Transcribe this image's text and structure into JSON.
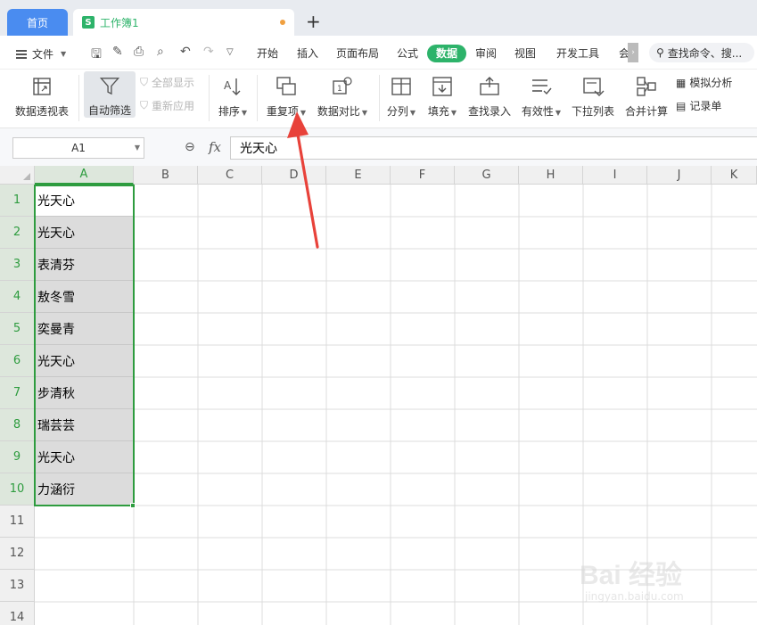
{
  "tabs": {
    "home": "首页",
    "doc_icon": "S",
    "doc_name": "工作簿1",
    "add": "+"
  },
  "menu": {
    "file": "文件",
    "tabs": [
      "开始",
      "插入",
      "页面布局",
      "公式",
      "数据",
      "审阅",
      "视图",
      "开发工具",
      "会"
    ],
    "active_tab": "数据",
    "search": "查找命令、搜...",
    "accent_color": "#2db36a"
  },
  "ribbon": {
    "pivot": "数据透视表",
    "autofilter": "自动筛选",
    "show_all": "全部显示",
    "reapply": "重新应用",
    "sort": "排序",
    "duplicates": "重复项",
    "compare": "数据对比",
    "split": "分列",
    "fill": "填充",
    "lookup_entry": "查找录入",
    "validity": "有效性",
    "dropdown_list": "下拉列表",
    "consolidate": "合并计算",
    "whatif": "模拟分析",
    "record": "记录单"
  },
  "formula_bar": {
    "name_box": "A1",
    "fx": "fx",
    "value": "光天心"
  },
  "sheet": {
    "columns": [
      "A",
      "B",
      "C",
      "D",
      "E",
      "F",
      "G",
      "H",
      "I",
      "J",
      "K"
    ],
    "rows": [
      "1",
      "2",
      "3",
      "4",
      "5",
      "6",
      "7",
      "8",
      "9",
      "10",
      "11",
      "12",
      "13",
      "14"
    ],
    "column_a": [
      "光天心",
      "光天心",
      "表清芬",
      "敖冬雪",
      "奕曼青",
      "光天心",
      "步清秋",
      "瑞芸芸",
      "光天心",
      "力涵衍"
    ],
    "selection_color": "#2e9c3f"
  },
  "watermark": {
    "title": "Bai 经验",
    "url": "jingyan.baidu.com"
  }
}
